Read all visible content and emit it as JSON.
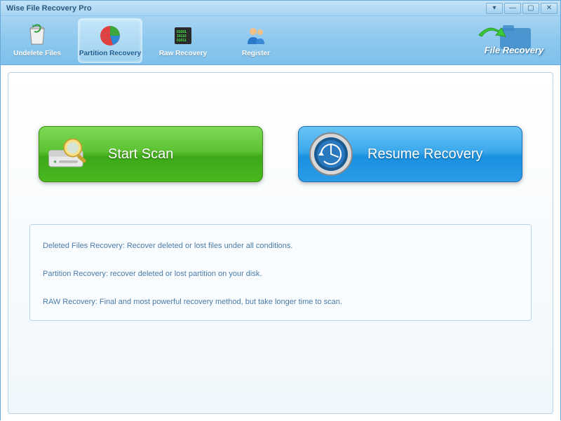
{
  "window": {
    "title": "Wise File Recovery Pro"
  },
  "controls": {
    "min": "—",
    "max": "▢",
    "close": "✕",
    "help": "▾"
  },
  "tabs": {
    "undelete": "Undelete Files",
    "partition": "Partition Recovery",
    "raw": "Raw Recovery",
    "register": "Register"
  },
  "brand": "File Recovery",
  "buttons": {
    "start": "Start  Scan",
    "resume": "Resume Recovery"
  },
  "info": {
    "l1": "Deleted Files Recovery: Recover deleted or lost files  under all conditions.",
    "l2": "Partition Recovery: recover deleted or lost partition on your disk.",
    "l3": "RAW Recovery: Final and most powerful recovery method, but take longer time to scan."
  }
}
